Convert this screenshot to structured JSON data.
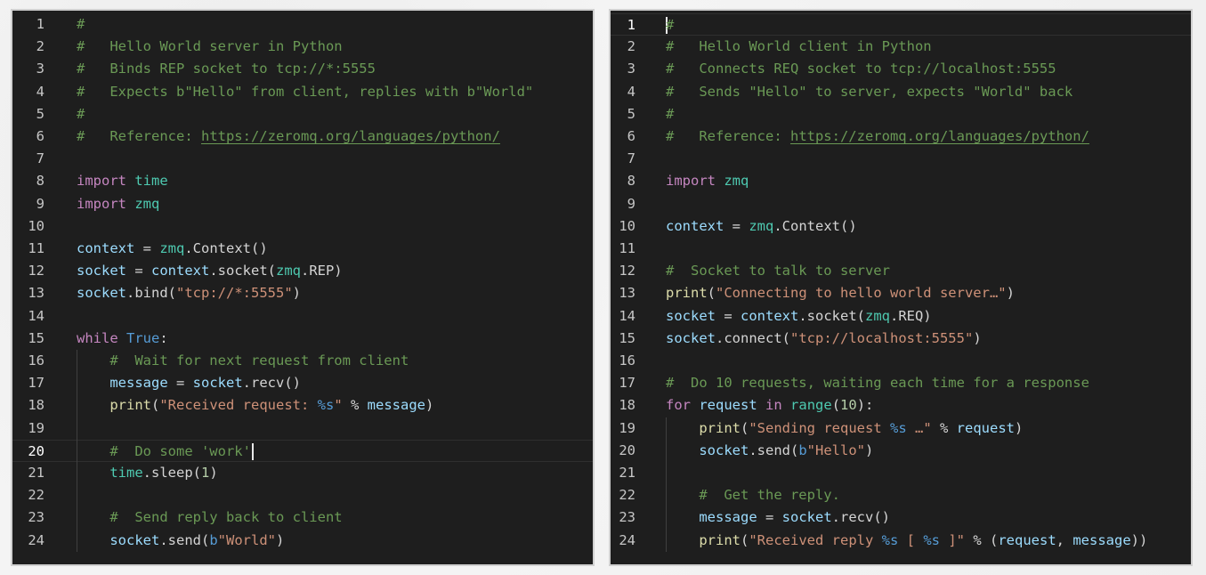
{
  "editors": [
    {
      "id": "server",
      "current_line": 20,
      "lines": [
        {
          "n": "1",
          "tokens": [
            {
              "c": "comment",
              "t": "#"
            }
          ]
        },
        {
          "n": "2",
          "tokens": [
            {
              "c": "comment",
              "t": "#   Hello World server in Python"
            }
          ]
        },
        {
          "n": "3",
          "tokens": [
            {
              "c": "comment",
              "t": "#   Binds REP socket to tcp://*:5555"
            }
          ]
        },
        {
          "n": "4",
          "tokens": [
            {
              "c": "comment",
              "t": "#   Expects b\"Hello\" from client, replies with b\"World\""
            }
          ]
        },
        {
          "n": "5",
          "tokens": [
            {
              "c": "comment",
              "t": "#"
            }
          ]
        },
        {
          "n": "6",
          "tokens": [
            {
              "c": "comment",
              "t": "#   Reference: "
            },
            {
              "c": "link",
              "t": "https://zeromq.org/languages/python/"
            }
          ]
        },
        {
          "n": "7",
          "tokens": []
        },
        {
          "n": "8",
          "tokens": [
            {
              "c": "keyword",
              "t": "import"
            },
            {
              "c": "plain",
              "t": " "
            },
            {
              "c": "module",
              "t": "time"
            }
          ]
        },
        {
          "n": "9",
          "tokens": [
            {
              "c": "keyword",
              "t": "import"
            },
            {
              "c": "plain",
              "t": " "
            },
            {
              "c": "module",
              "t": "zmq"
            }
          ]
        },
        {
          "n": "10",
          "tokens": []
        },
        {
          "n": "11",
          "tokens": [
            {
              "c": "ident",
              "t": "context"
            },
            {
              "c": "plain",
              "t": " = "
            },
            {
              "c": "module",
              "t": "zmq"
            },
            {
              "c": "plain",
              "t": ".Context()"
            }
          ]
        },
        {
          "n": "12",
          "tokens": [
            {
              "c": "ident",
              "t": "socket"
            },
            {
              "c": "plain",
              "t": " = "
            },
            {
              "c": "ident",
              "t": "context"
            },
            {
              "c": "plain",
              "t": ".socket("
            },
            {
              "c": "module",
              "t": "zmq"
            },
            {
              "c": "plain",
              "t": ".REP)"
            }
          ]
        },
        {
          "n": "13",
          "tokens": [
            {
              "c": "ident",
              "t": "socket"
            },
            {
              "c": "plain",
              "t": ".bind("
            },
            {
              "c": "string",
              "t": "\"tcp://*:5555\""
            },
            {
              "c": "plain",
              "t": ")"
            }
          ]
        },
        {
          "n": "14",
          "tokens": []
        },
        {
          "n": "15",
          "tokens": [
            {
              "c": "keyword",
              "t": "while"
            },
            {
              "c": "plain",
              "t": " "
            },
            {
              "c": "constant",
              "t": "True"
            },
            {
              "c": "plain",
              "t": ":"
            }
          ]
        },
        {
          "n": "16",
          "tokens": [
            {
              "c": "plain",
              "t": "    "
            },
            {
              "c": "comment",
              "t": "#  Wait for next request from client"
            }
          ]
        },
        {
          "n": "17",
          "tokens": [
            {
              "c": "plain",
              "t": "    "
            },
            {
              "c": "ident",
              "t": "message"
            },
            {
              "c": "plain",
              "t": " = "
            },
            {
              "c": "ident",
              "t": "socket"
            },
            {
              "c": "plain",
              "t": ".recv()"
            }
          ]
        },
        {
          "n": "18",
          "tokens": [
            {
              "c": "plain",
              "t": "    "
            },
            {
              "c": "func",
              "t": "print"
            },
            {
              "c": "plain",
              "t": "("
            },
            {
              "c": "string",
              "t": "\"Received request: "
            },
            {
              "c": "format",
              "t": "%s"
            },
            {
              "c": "string",
              "t": "\""
            },
            {
              "c": "plain",
              "t": " % "
            },
            {
              "c": "ident",
              "t": "message"
            },
            {
              "c": "plain",
              "t": ")"
            }
          ]
        },
        {
          "n": "19",
          "tokens": []
        },
        {
          "n": "20",
          "tokens": [
            {
              "c": "plain",
              "t": "    "
            },
            {
              "c": "comment",
              "t": "#  Do some 'work'"
            }
          ],
          "cursor": true
        },
        {
          "n": "21",
          "tokens": [
            {
              "c": "plain",
              "t": "    "
            },
            {
              "c": "module",
              "t": "time"
            },
            {
              "c": "plain",
              "t": ".sleep("
            },
            {
              "c": "number",
              "t": "1"
            },
            {
              "c": "plain",
              "t": ")"
            }
          ]
        },
        {
          "n": "22",
          "tokens": []
        },
        {
          "n": "23",
          "tokens": [
            {
              "c": "plain",
              "t": "    "
            },
            {
              "c": "comment",
              "t": "#  Send reply back to client"
            }
          ]
        },
        {
          "n": "24",
          "tokens": [
            {
              "c": "plain",
              "t": "    "
            },
            {
              "c": "ident",
              "t": "socket"
            },
            {
              "c": "plain",
              "t": ".send("
            },
            {
              "c": "bprefix",
              "t": "b"
            },
            {
              "c": "string",
              "t": "\"World\""
            },
            {
              "c": "plain",
              "t": ")"
            }
          ]
        }
      ]
    },
    {
      "id": "client",
      "current_line": 1,
      "lines": [
        {
          "n": "1",
          "tokens": [
            {
              "c": "comment",
              "t": "#"
            }
          ],
          "cursor_before": true
        },
        {
          "n": "2",
          "tokens": [
            {
              "c": "comment",
              "t": "#   Hello World client in Python"
            }
          ]
        },
        {
          "n": "3",
          "tokens": [
            {
              "c": "comment",
              "t": "#   Connects REQ socket to tcp://localhost:5555"
            }
          ]
        },
        {
          "n": "4",
          "tokens": [
            {
              "c": "comment",
              "t": "#   Sends \"Hello\" to server, expects \"World\" back"
            }
          ]
        },
        {
          "n": "5",
          "tokens": [
            {
              "c": "comment",
              "t": "#"
            }
          ]
        },
        {
          "n": "6",
          "tokens": [
            {
              "c": "comment",
              "t": "#   Reference: "
            },
            {
              "c": "link",
              "t": "https://zeromq.org/languages/python/"
            }
          ]
        },
        {
          "n": "7",
          "tokens": []
        },
        {
          "n": "8",
          "tokens": [
            {
              "c": "keyword",
              "t": "import"
            },
            {
              "c": "plain",
              "t": " "
            },
            {
              "c": "module",
              "t": "zmq"
            }
          ]
        },
        {
          "n": "9",
          "tokens": []
        },
        {
          "n": "10",
          "tokens": [
            {
              "c": "ident",
              "t": "context"
            },
            {
              "c": "plain",
              "t": " = "
            },
            {
              "c": "module",
              "t": "zmq"
            },
            {
              "c": "plain",
              "t": ".Context()"
            }
          ]
        },
        {
          "n": "11",
          "tokens": []
        },
        {
          "n": "12",
          "tokens": [
            {
              "c": "comment",
              "t": "#  Socket to talk to server"
            }
          ]
        },
        {
          "n": "13",
          "tokens": [
            {
              "c": "func",
              "t": "print"
            },
            {
              "c": "plain",
              "t": "("
            },
            {
              "c": "string",
              "t": "\"Connecting to hello world server…\""
            },
            {
              "c": "plain",
              "t": ")"
            }
          ]
        },
        {
          "n": "14",
          "tokens": [
            {
              "c": "ident",
              "t": "socket"
            },
            {
              "c": "plain",
              "t": " = "
            },
            {
              "c": "ident",
              "t": "context"
            },
            {
              "c": "plain",
              "t": ".socket("
            },
            {
              "c": "module",
              "t": "zmq"
            },
            {
              "c": "plain",
              "t": ".REQ)"
            }
          ]
        },
        {
          "n": "15",
          "tokens": [
            {
              "c": "ident",
              "t": "socket"
            },
            {
              "c": "plain",
              "t": ".connect("
            },
            {
              "c": "string",
              "t": "\"tcp://localhost:5555\""
            },
            {
              "c": "plain",
              "t": ")"
            }
          ]
        },
        {
          "n": "16",
          "tokens": []
        },
        {
          "n": "17",
          "tokens": [
            {
              "c": "comment",
              "t": "#  Do 10 requests, waiting each time for a response"
            }
          ]
        },
        {
          "n": "18",
          "tokens": [
            {
              "c": "keyword",
              "t": "for"
            },
            {
              "c": "plain",
              "t": " "
            },
            {
              "c": "ident",
              "t": "request"
            },
            {
              "c": "plain",
              "t": " "
            },
            {
              "c": "keyword",
              "t": "in"
            },
            {
              "c": "plain",
              "t": " "
            },
            {
              "c": "builtin",
              "t": "range"
            },
            {
              "c": "plain",
              "t": "("
            },
            {
              "c": "number",
              "t": "10"
            },
            {
              "c": "plain",
              "t": "):"
            }
          ]
        },
        {
          "n": "19",
          "tokens": [
            {
              "c": "plain",
              "t": "    "
            },
            {
              "c": "func",
              "t": "print"
            },
            {
              "c": "plain",
              "t": "("
            },
            {
              "c": "string",
              "t": "\"Sending request "
            },
            {
              "c": "format",
              "t": "%s"
            },
            {
              "c": "string",
              "t": " …\""
            },
            {
              "c": "plain",
              "t": " % "
            },
            {
              "c": "ident",
              "t": "request"
            },
            {
              "c": "plain",
              "t": ")"
            }
          ]
        },
        {
          "n": "20",
          "tokens": [
            {
              "c": "plain",
              "t": "    "
            },
            {
              "c": "ident",
              "t": "socket"
            },
            {
              "c": "plain",
              "t": ".send("
            },
            {
              "c": "bprefix",
              "t": "b"
            },
            {
              "c": "string",
              "t": "\"Hello\""
            },
            {
              "c": "plain",
              "t": ")"
            }
          ]
        },
        {
          "n": "21",
          "tokens": []
        },
        {
          "n": "22",
          "tokens": [
            {
              "c": "plain",
              "t": "    "
            },
            {
              "c": "comment",
              "t": "#  Get the reply."
            }
          ]
        },
        {
          "n": "23",
          "tokens": [
            {
              "c": "plain",
              "t": "    "
            },
            {
              "c": "ident",
              "t": "message"
            },
            {
              "c": "plain",
              "t": " = "
            },
            {
              "c": "ident",
              "t": "socket"
            },
            {
              "c": "plain",
              "t": ".recv()"
            }
          ]
        },
        {
          "n": "24",
          "tokens": [
            {
              "c": "plain",
              "t": "    "
            },
            {
              "c": "func",
              "t": "print"
            },
            {
              "c": "plain",
              "t": "("
            },
            {
              "c": "string",
              "t": "\"Received reply "
            },
            {
              "c": "format",
              "t": "%s"
            },
            {
              "c": "string",
              "t": " [ "
            },
            {
              "c": "format",
              "t": "%s"
            },
            {
              "c": "string",
              "t": " ]\""
            },
            {
              "c": "plain",
              "t": " % ("
            },
            {
              "c": "ident",
              "t": "request"
            },
            {
              "c": "plain",
              "t": ", "
            },
            {
              "c": "ident",
              "t": "message"
            },
            {
              "c": "plain",
              "t": "))"
            }
          ]
        }
      ]
    }
  ],
  "colors": {
    "background": "#1e1e1e",
    "comment": "#6a9955",
    "keyword": "#c586c0",
    "module": "#4ec9b0",
    "string": "#ce9178",
    "constant": "#569cd6",
    "identifier": "#9cdcfe",
    "function": "#dcdcaa",
    "line_number": "#c6c6c6"
  }
}
